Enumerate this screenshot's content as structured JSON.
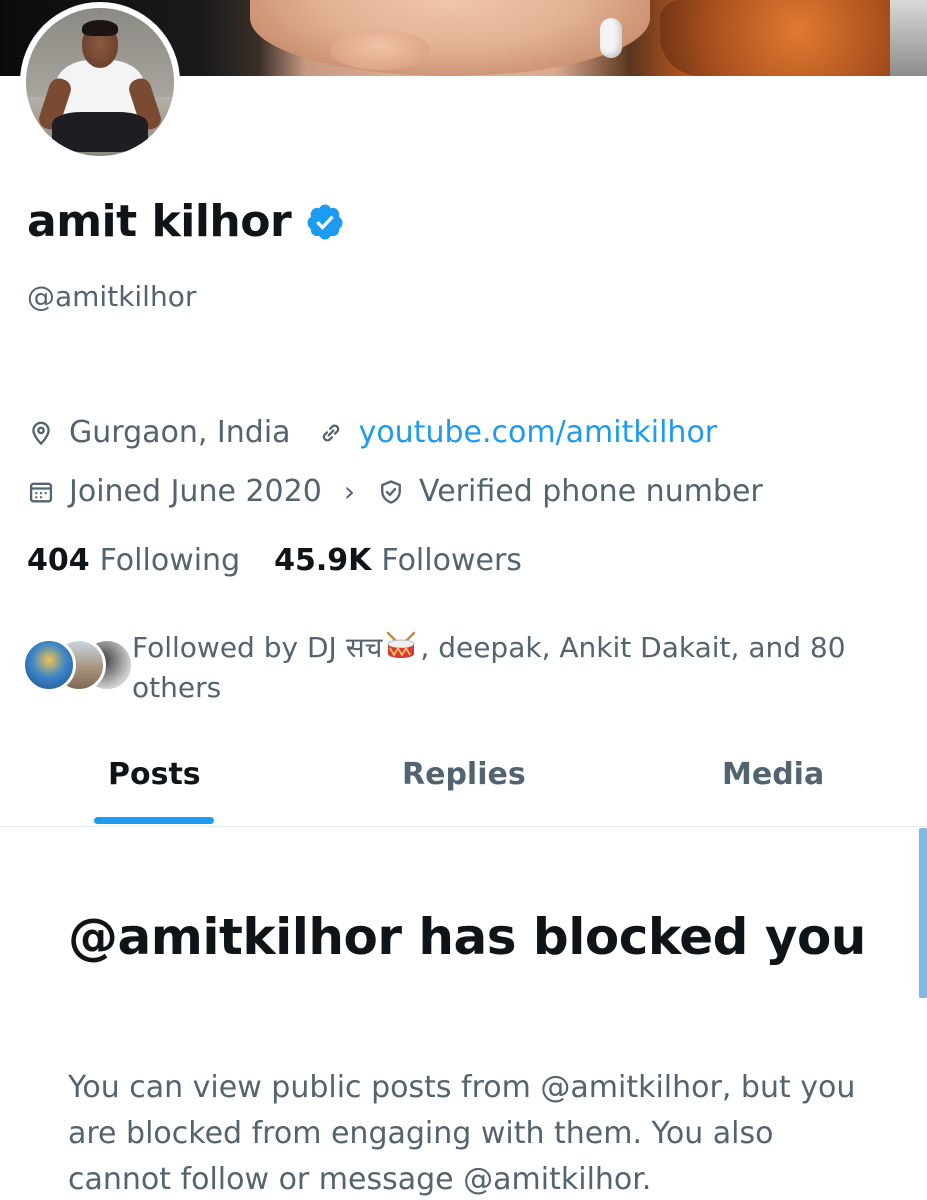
{
  "profile": {
    "display_name": "amit kilhor",
    "handle": "@amitkilhor",
    "location": "Gurgaon, India",
    "website": "youtube.com/amitkilhor",
    "joined": "Joined June 2020",
    "verified_phone": "Verified phone number",
    "following_count": "404",
    "following_label": "Following",
    "followers_count": "45.9K",
    "followers_label": "Followers",
    "followed_by_prefix": "Followed by DJ सच",
    "followed_by_suffix": ", deepak, Ankit Dakait, and 80 others"
  },
  "icons": {
    "location": "location-pin-icon",
    "link": "link-icon",
    "calendar": "calendar-icon",
    "chevron": "chevron-right-icon",
    "shield": "shield-check-icon",
    "verified": "verified-badge-icon"
  },
  "tabs": [
    {
      "label": "Posts",
      "active": true
    },
    {
      "label": "Replies",
      "active": false
    },
    {
      "label": "Media",
      "active": false
    }
  ],
  "chevron_glyph": "›",
  "blocked": {
    "title": "@amitkilhor has blocked you",
    "body": "You can view public posts from @amitkilhor, but you are blocked from engaging with them. You also cannot follow or message @amitkilhor."
  },
  "colors": {
    "accent": "#1d9bf0",
    "text_primary": "#0f1419",
    "text_secondary": "#536471"
  }
}
